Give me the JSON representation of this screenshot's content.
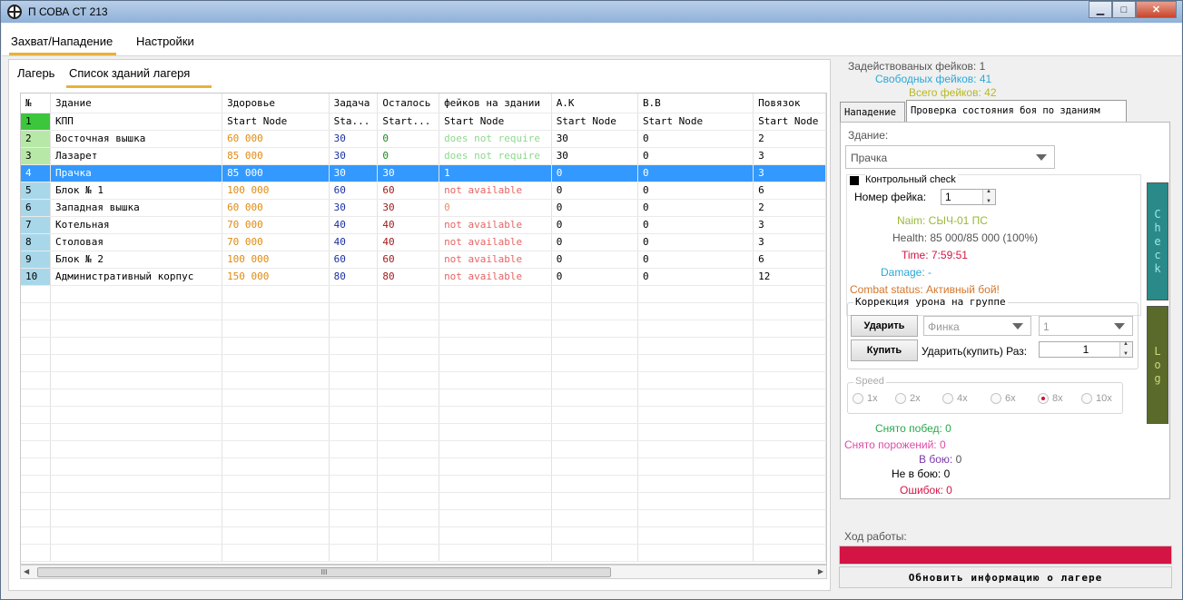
{
  "window": {
    "title": "П СОВА СТ 213",
    "controls": {
      "minimize": "▁",
      "maximize": "□",
      "close": "✕"
    }
  },
  "menu": {
    "tabs": [
      "Захват/Нападение",
      "Настройки"
    ],
    "active_index": 0
  },
  "left": {
    "subtabs": [
      "Лагерь",
      "Список зданий лагеря"
    ],
    "active_subtab": 1,
    "table": {
      "headers": [
        "№",
        "Здание",
        "Здоровье",
        "Задача",
        "Осталось",
        "фейков на здании",
        "А.К",
        "В.В",
        "Повязок"
      ],
      "rows": [
        {
          "idx": "1",
          "name": "КПП",
          "health": "Start Node",
          "task": "Sta...",
          "left": "Start...",
          "fakes": "Start Node",
          "ak": "Start Node",
          "vv": "Start Node",
          "bandages": "Start Node"
        },
        {
          "idx": "2",
          "name": "Восточная вышка",
          "health": "60 000",
          "task": "30",
          "left": "0",
          "fakes": "does not require",
          "ak": "30",
          "vv": "0",
          "bandages": "2"
        },
        {
          "idx": "3",
          "name": "Лазарет",
          "health": "85 000",
          "task": "30",
          "left": "0",
          "fakes": "does not require",
          "ak": "30",
          "vv": "0",
          "bandages": "3"
        },
        {
          "idx": "4",
          "name": "Прачка",
          "health": "85 000",
          "task": "30",
          "left": "30",
          "fakes": "1",
          "ak": "0",
          "vv": "0",
          "bandages": "3"
        },
        {
          "idx": "5",
          "name": "Блок № 1",
          "health": "100 000",
          "task": "60",
          "left": "60",
          "fakes": "not available",
          "ak": "0",
          "vv": "0",
          "bandages": "6"
        },
        {
          "idx": "6",
          "name": "Западная вышка",
          "health": "60 000",
          "task": "30",
          "left": "30",
          "fakes": "0",
          "ak": "0",
          "vv": "0",
          "bandages": "2"
        },
        {
          "idx": "7",
          "name": "Котельная",
          "health": "70 000",
          "task": "40",
          "left": "40",
          "fakes": "not available",
          "ak": "0",
          "vv": "0",
          "bandages": "3"
        },
        {
          "idx": "8",
          "name": "Столовая",
          "health": "70 000",
          "task": "40",
          "left": "40",
          "fakes": "not available",
          "ak": "0",
          "vv": "0",
          "bandages": "3"
        },
        {
          "idx": "9",
          "name": "Блок № 2",
          "health": "100 000",
          "task": "60",
          "left": "60",
          "fakes": "not available",
          "ak": "0",
          "vv": "0",
          "bandages": "6"
        },
        {
          "idx": "10",
          "name": "Административный корпус",
          "health": "150 000",
          "task": "80",
          "left": "80",
          "fakes": "not available",
          "ak": "0",
          "vv": "0",
          "bandages": "12"
        }
      ],
      "selected_row": 3
    },
    "scroll_grip": "III"
  },
  "right": {
    "stats_top": [
      {
        "label": "Задействованых фейков:",
        "value": "1",
        "color": "#555555"
      },
      {
        "label": "Свободных фейков:",
        "value": "41",
        "color": "#2aa8d8"
      },
      {
        "label": "Всего фейков:",
        "value": "42",
        "color": "#b8b820"
      }
    ],
    "tabs": [
      "Нападение",
      "Проверка состояния боя по зданиям"
    ],
    "active_tab": 1,
    "building_label": "Здание:",
    "building_value": "Прачка",
    "control_check_label": "Контрольный check",
    "fake_number_label": "Номер фейка:",
    "fake_number_value": "1",
    "info": {
      "naim": "Naim: СЫЧ-01 ПС",
      "health": "Health: 85 000/85 000 (100%)",
      "time": "Time: 7:59:51",
      "damage": "Damage: -",
      "combat_status": "Combat status: Активный бой!"
    },
    "correction": {
      "legend": "Коррекция урона на группе",
      "strike_btn": "Ударить",
      "buy_btn": "Купить",
      "item_combo": "Финка",
      "count_combo": "1",
      "times_label": "Ударить(купить) Раз:",
      "times_value": "1"
    },
    "speed": {
      "legend": "Speed",
      "options": [
        "1x",
        "2x",
        "4x",
        "6x",
        "8x",
        "10x"
      ],
      "selected": 4
    },
    "check_btn": [
      "C",
      "h",
      "e",
      "c",
      "k"
    ],
    "log_btn": [
      "L",
      "o",
      "g"
    ],
    "counters": [
      {
        "label": "Снято побед:",
        "value": "0",
        "color": "#2aa84a"
      },
      {
        "label": "Снято порожений:",
        "value": "0",
        "color": "#e04aa8"
      },
      {
        "label": "В бою:",
        "value": "0",
        "color": "#7a3aa8"
      },
      {
        "label": "Не в бою:",
        "value": "0",
        "color": "#000000"
      },
      {
        "label": "Ошибок:",
        "value": "0",
        "color": "#d41444"
      }
    ],
    "progress_label": "Ход работы:",
    "progress_value": 1.0,
    "update_btn": "Обновить информацию о лагере"
  }
}
